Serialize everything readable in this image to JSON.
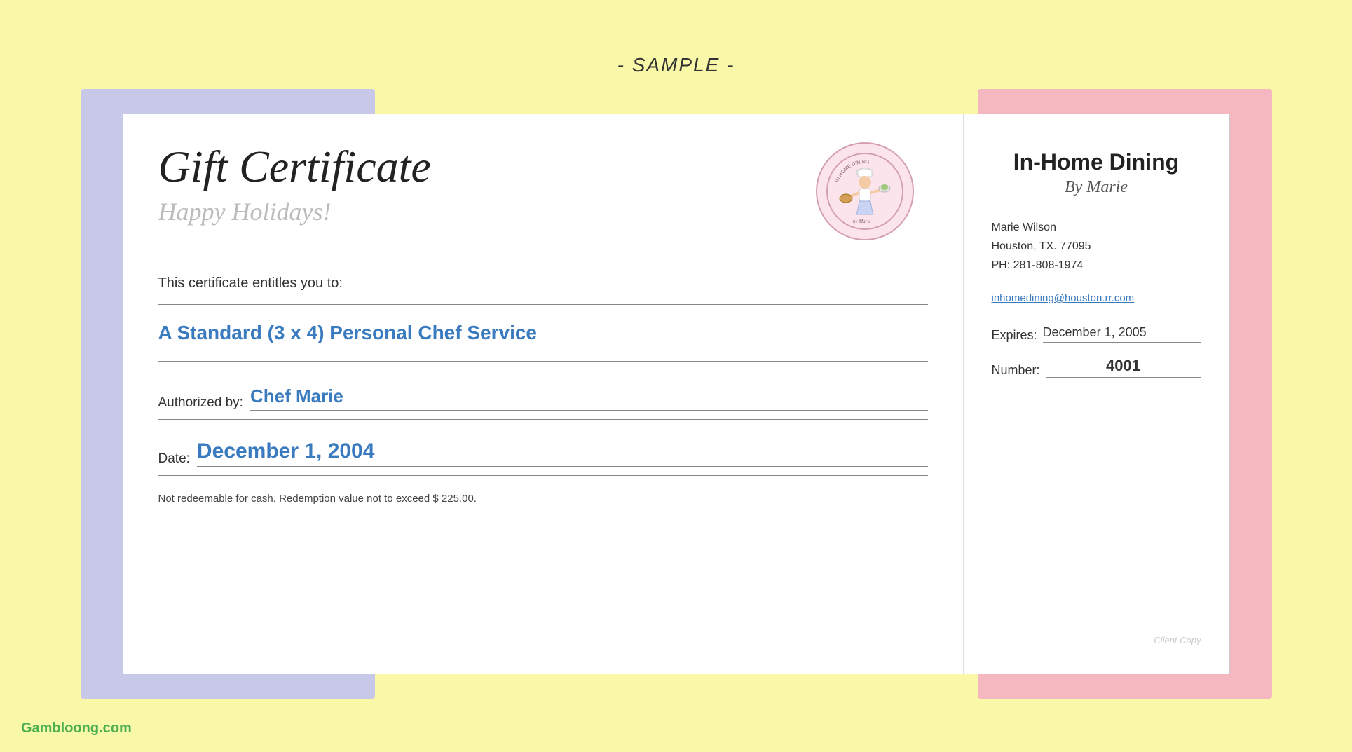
{
  "page": {
    "background_color": "#f9f7a8",
    "sample_label": "- SAMPLE -",
    "site_watermark": "Gambloong.com"
  },
  "certificate": {
    "title": "Gift Certificate",
    "subtitle": "Happy Holidays!",
    "entitles_text": "This certificate entitles you to:",
    "service_name": "A Standard (3 x 4) Personal Chef Service",
    "authorized_label": "Authorized by:",
    "authorized_value": "Chef Marie",
    "date_label": "Date:",
    "date_value": "December 1, 2004",
    "fine_print": "Not redeemable for cash. Redemption value not to exceed $ 225.00.",
    "logo_alt": "In-Home Dining by Marie logo",
    "business_name": "In-Home Dining",
    "business_subtitle": "By Marie",
    "contact": {
      "name": "Marie Wilson",
      "address": "Houston, TX.  77095",
      "phone": "PH: 281-808-1974"
    },
    "email": "inhomedining@houston.rr.com",
    "expires_label": "Expires:",
    "expires_value": "December 1, 2005",
    "number_label": "Number:",
    "number_value": "4001",
    "client_copy": "Client Copy"
  }
}
